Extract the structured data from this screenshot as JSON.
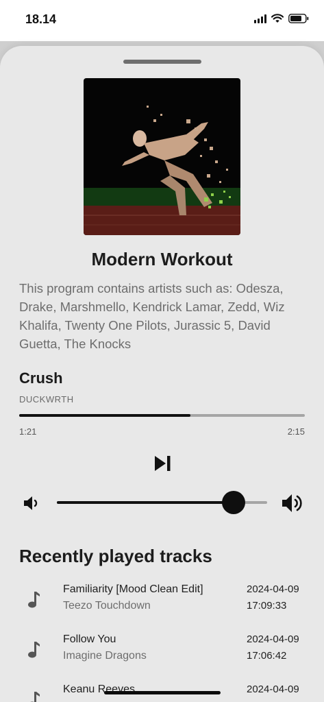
{
  "status": {
    "time": "18.14"
  },
  "program": {
    "title": "Modern Workout",
    "description": "This program contains artists such as: Odesza, Drake, Marshmello, Kendrick Lamar, Zedd, Wiz Khalifa, Twenty One Pilots, Jurassic 5, David Guetta, The Knocks"
  },
  "now_playing": {
    "title": "Crush",
    "artist": "DUCKWRTH",
    "elapsed": "1:21",
    "duration": "2:15",
    "progress": 0.6
  },
  "volume": {
    "level": 0.84
  },
  "recent": {
    "heading": "Recently played tracks",
    "tracks": [
      {
        "title": "Familiarity [Mood Clean Edit]",
        "artist": "Teezo Touchdown",
        "date": "2024-04-09",
        "time": "17:09:33"
      },
      {
        "title": "Follow You",
        "artist": "Imagine Dragons",
        "date": "2024-04-09",
        "time": "17:06:42"
      },
      {
        "title": "Keanu Reeves",
        "artist": "",
        "date": "2024-04-09",
        "time": ""
      }
    ]
  },
  "colors": {
    "accent": "#111111",
    "track_bg": "#a5a5a5",
    "sheet": "#e8e8e8"
  }
}
